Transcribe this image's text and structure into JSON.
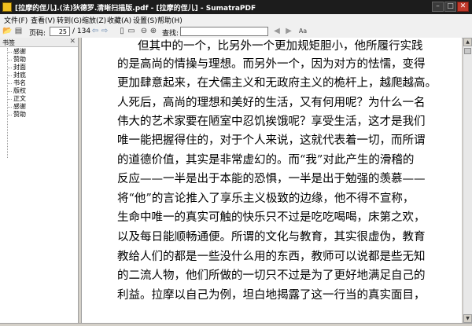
{
  "window": {
    "title": "[拉摩的侄儿].(法)狄德罗.清晰扫描版.pdf - [拉摩的侄儿] - SumatraPDF",
    "minimize_glyph": "–",
    "maximize_glyph": "□",
    "close_glyph": "✕"
  },
  "menu": {
    "items": [
      {
        "label": "文件(F)"
      },
      {
        "label": "查看(V)"
      },
      {
        "label": "转到(G)"
      },
      {
        "label": "缩放(Z)"
      },
      {
        "label": "收藏(A)"
      },
      {
        "label": "设置(S)"
      },
      {
        "label": "帮助(H)"
      }
    ]
  },
  "toolbar": {
    "page_label": "页码:",
    "page_value": "25",
    "page_total": "/ 134",
    "search_label": "查找:",
    "search_value": "",
    "icons": [
      "open-icon",
      "print-icon",
      "back-icon",
      "forward-icon",
      "fit-page-icon",
      "fit-width-icon",
      "zoom-out-icon",
      "zoom-in-icon",
      "search-prev-icon",
      "search-next-icon",
      "match-case-icon"
    ]
  },
  "sidebar": {
    "title": "书签",
    "close_glyph": "✕",
    "items": [
      {
        "label": "感谢"
      },
      {
        "label": "赞助"
      },
      {
        "label": "封面"
      },
      {
        "label": "封底"
      },
      {
        "label": "书名"
      },
      {
        "label": "版权"
      },
      {
        "label": "正文"
      },
      {
        "label": "感谢"
      },
      {
        "label": "赞助"
      }
    ]
  },
  "document": {
    "page_number": 25,
    "lines": [
      "但其中的一个，比另外一个更加规矩胆小，他所履行实践",
      "的是高尚的情操与理想。而另外一个，因为对方的怯懦，变得",
      "更加肆意起来，在犬儒主义和无政府主义的桅杆上，越爬越高。",
      "人死后，高尚的理想和美好的生活，又有何用呢？为什么一名",
      "伟大的艺术家要在陋室中忍饥挨饿呢？享受生活，这才是我们",
      "唯一能把握得住的，对于个人来说，这就代表着一切，而所谓",
      "的道德价值，其实是非常虚幻的。而“我”对此产生的滑稽的",
      "反应——一半是出于本能的恐惧，一半是出于勉强的羡慕——",
      "将“他”的言论推入了享乐主义极致的边缘，他不得不宣称，",
      "生命中唯一的真实可触的快乐只不过是吃吃喝喝，床第之欢，",
      "以及每日能顺畅通便。所谓的文化与教育，其实很虚伪，教育",
      "教给人们的都是一些没什么用的东西，教师可以说都是些无知",
      "的二流人物，他们所做的一切只不过是为了更好地满足自己的",
      "利益。拉摩以自己为例，坦白地揭露了这一行当的真实面目，"
    ]
  },
  "scrollbar": {
    "up_glyph": "▲",
    "down_glyph": "▼",
    "position": 0.18
  }
}
